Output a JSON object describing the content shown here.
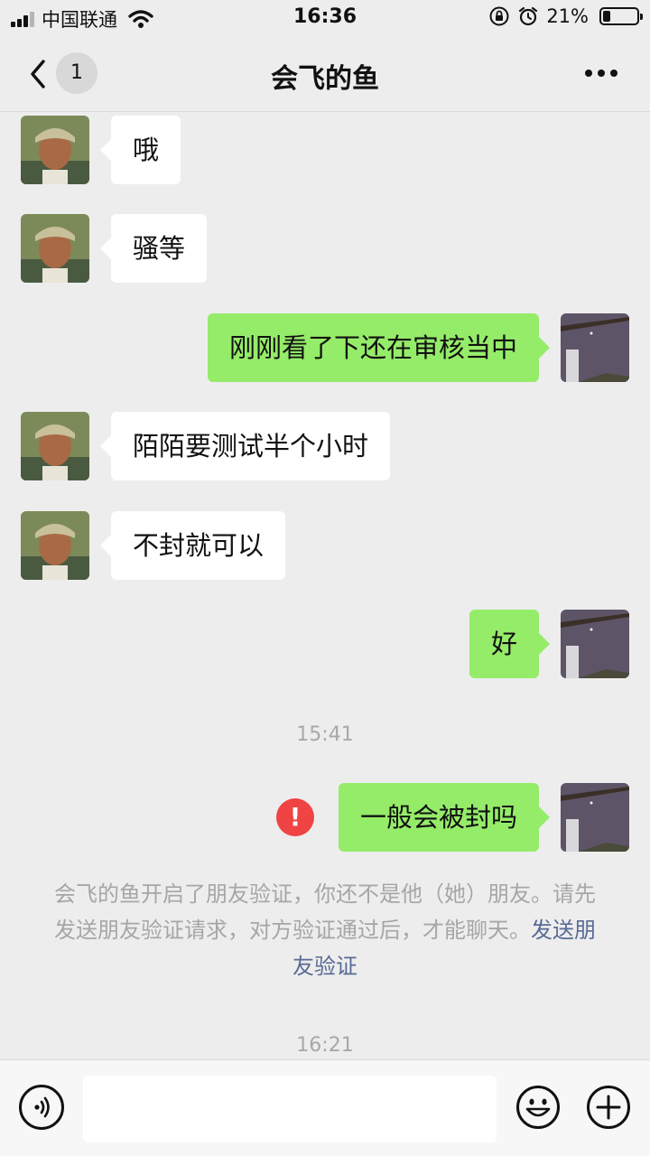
{
  "status_bar": {
    "carrier": "中国联通",
    "time": "16:36",
    "battery": "21%",
    "battery_level": 0.21
  },
  "nav": {
    "unread_count": "1",
    "title": "会飞的鱼"
  },
  "messages": [
    {
      "from": "other",
      "text": "哦"
    },
    {
      "from": "other",
      "text": "骚等"
    },
    {
      "from": "me",
      "text": "刚刚看了下还在审核当中"
    },
    {
      "from": "other",
      "text": "陌陌要测试半个小时"
    },
    {
      "from": "other",
      "text": "不封就可以"
    },
    {
      "from": "me",
      "text": "好"
    },
    {
      "timestamp": "15:41"
    },
    {
      "from": "me",
      "text": "一般会被封吗",
      "status": "failed"
    }
  ],
  "system_notice": {
    "text": "会飞的鱼开启了朋友验证，你还不是他（她）朋友。请先发送朋友验证请求，对方验证通过后，才能聊天。",
    "link": "发送朋友验证"
  },
  "last_timestamp": "16:21",
  "input": {
    "value": "",
    "placeholder": ""
  },
  "icons": {
    "back": "chevron-left-icon",
    "more": "more-icon",
    "voice": "voice-icon",
    "emoji": "emoji-icon",
    "plus": "plus-icon",
    "fail": "error-icon"
  }
}
